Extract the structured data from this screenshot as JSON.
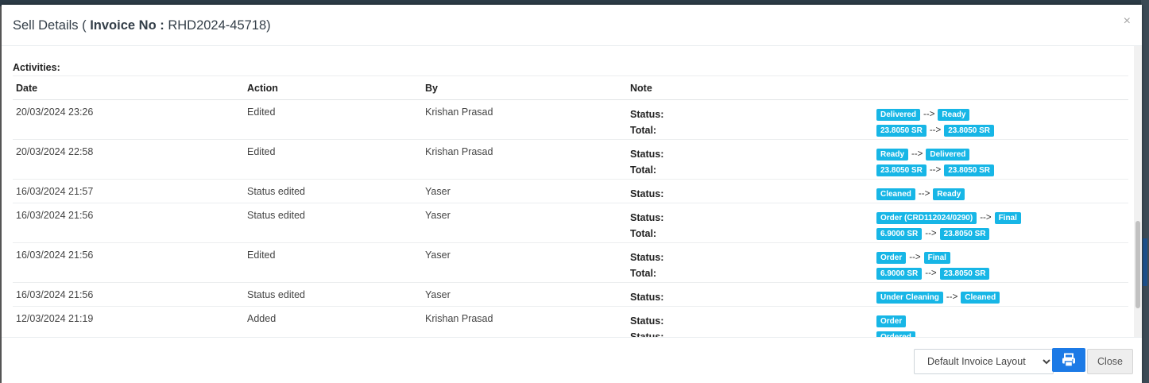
{
  "modal": {
    "title_prefix": "Sell Details (",
    "title_label": "Invoice No :",
    "invoice_no": "RHD2024-45718)",
    "close_symbol": "×"
  },
  "activities": {
    "section_title": "Activities:",
    "columns": {
      "date": "Date",
      "action": "Action",
      "by": "By",
      "note": "Note"
    },
    "arrow": "-->",
    "rows": [
      {
        "date": "20/03/2024 23:26",
        "action": "Edited",
        "by": "Krishan Prasad",
        "notes": [
          {
            "label": "Status:",
            "from": "Delivered",
            "to": "Ready"
          },
          {
            "label": "Total:",
            "from": "23.8050 SR",
            "to": "23.8050 SR"
          }
        ]
      },
      {
        "date": "20/03/2024 22:58",
        "action": "Edited",
        "by": "Krishan Prasad",
        "notes": [
          {
            "label": "Status:",
            "from": "Ready",
            "to": "Delivered"
          },
          {
            "label": "Total:",
            "from": "23.8050 SR",
            "to": "23.8050 SR"
          }
        ]
      },
      {
        "date": "16/03/2024 21:57",
        "action": "Status edited",
        "by": "Yaser",
        "notes": [
          {
            "label": "Status:",
            "from": "Cleaned",
            "to": "Ready"
          }
        ]
      },
      {
        "date": "16/03/2024 21:56",
        "action": "Status edited",
        "by": "Yaser",
        "notes": [
          {
            "label": "Status:",
            "from": "Order (CRD112024/0290)",
            "to": "Final"
          },
          {
            "label": "Total:",
            "from": "6.9000 SR",
            "to": "23.8050 SR"
          }
        ]
      },
      {
        "date": "16/03/2024 21:56",
        "action": "Edited",
        "by": "Yaser",
        "notes": [
          {
            "label": "Status:",
            "from": "Order",
            "to": "Final"
          },
          {
            "label": "Total:",
            "from": "6.9000 SR",
            "to": "23.8050 SR"
          }
        ]
      },
      {
        "date": "16/03/2024 21:56",
        "action": "Status edited",
        "by": "Yaser",
        "notes": [
          {
            "label": "Status:",
            "from": "Under Cleaning",
            "to": "Cleaned"
          }
        ]
      },
      {
        "date": "12/03/2024 21:19",
        "action": "Added",
        "by": "Krishan Prasad",
        "notes": [
          {
            "label": "Status:",
            "value": "Order"
          },
          {
            "label": "Status:",
            "value": "Ordered"
          }
        ]
      }
    ]
  },
  "footer": {
    "layout_select_value": "Default Invoice Layout",
    "print_icon": "printer-icon",
    "close_label": "Close"
  },
  "colors": {
    "tag_bg": "#17b6e6",
    "print_button": "#1c7ae6"
  }
}
